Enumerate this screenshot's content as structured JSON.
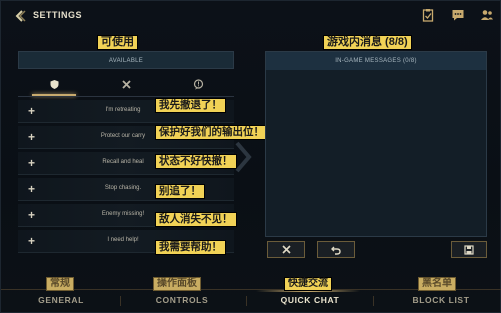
{
  "header": {
    "title": "SETTINGS",
    "icons": [
      "back-arrow-icon",
      "clipboard-check-icon",
      "chat-bubble-icon",
      "friends-icon"
    ]
  },
  "left_panel": {
    "cn_label": "可使用",
    "heading": "AVAILABLE",
    "tabs": [
      {
        "icon": "shield-icon",
        "active": true
      },
      {
        "icon": "crossed-swords-icon",
        "active": false
      },
      {
        "icon": "chat-exclamation-icon",
        "active": false
      }
    ],
    "rows": [
      {
        "plus": "+",
        "text": "I'm retreating",
        "cn": "我先撤退了！"
      },
      {
        "plus": "+",
        "text": "Protect our carry",
        "cn": "保护好我们的输出位！"
      },
      {
        "plus": "+",
        "text": "Recall and heal",
        "cn": "状态不好快撤！"
      },
      {
        "plus": "+",
        "text": "Stop chasing.",
        "cn": "别追了！"
      },
      {
        "plus": "+",
        "text": "Enemy missing!",
        "cn": "敌人消失不见！"
      },
      {
        "plus": "+",
        "text": "I need help!",
        "cn": "我需要帮助！"
      }
    ]
  },
  "right_panel": {
    "cn_label": "游戏内消息 (8/8)",
    "heading": "IN-GAME MESSAGES (0/8)",
    "buttons": [
      {
        "icon": "close-x-icon"
      },
      {
        "icon": "undo-arrow-icon"
      },
      {
        "icon": "save-disk-icon"
      }
    ]
  },
  "nav": {
    "items": [
      {
        "label": "GENERAL",
        "cn": "常规",
        "active": false
      },
      {
        "label": "CONTROLS",
        "cn": "操作面板",
        "active": false
      },
      {
        "label": "QUICK CHAT",
        "cn": "快捷交流",
        "active": true
      },
      {
        "label": "BLOCK LIST",
        "cn": "黑名单",
        "active": false
      }
    ]
  },
  "colors": {
    "gold": "#c8aa6e",
    "annotation": "#f1d256",
    "panel_header": "#1a2b37",
    "background": "#0b1016"
  }
}
